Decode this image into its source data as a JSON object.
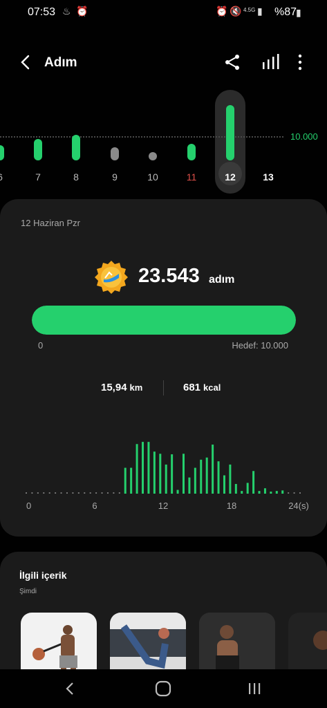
{
  "status": {
    "time": "07:53",
    "battery": "%87",
    "network": "4.5G"
  },
  "header": {
    "title": "Adım"
  },
  "week": {
    "goal_label": "10.000",
    "days": [
      {
        "label": "6",
        "steps_ratio": 0.65,
        "color": "green"
      },
      {
        "label": "7",
        "steps_ratio": 0.9,
        "color": "green"
      },
      {
        "label": "8",
        "steps_ratio": 1.1,
        "color": "green"
      },
      {
        "label": "9",
        "steps_ratio": 0.55,
        "color": "gray"
      },
      {
        "label": "10",
        "steps_ratio": 0.0,
        "color": "gray"
      },
      {
        "label": "11",
        "steps_ratio": 0.7,
        "color": "green"
      },
      {
        "label": "12",
        "steps_ratio": 2.35,
        "color": "green"
      },
      {
        "label": "13",
        "steps_ratio": 0,
        "color": "none"
      }
    ],
    "selected": "12"
  },
  "card": {
    "date": "12 Haziran Pzr",
    "steps": "23.543",
    "steps_unit": "adım",
    "progress_fraction": 1.0,
    "progress_min": "0",
    "goal_text": "Hedef: 10.000",
    "distance_value": "15,94",
    "distance_unit": "km",
    "calorie_value": "681",
    "calorie_unit": "kcal"
  },
  "chart_data": {
    "type": "bar",
    "x_ticks": [
      "0",
      "6",
      "12",
      "18",
      "24(s)"
    ],
    "xlim": [
      0,
      24
    ],
    "half_hour_values": [
      0,
      0,
      0,
      0,
      0,
      0,
      0,
      0,
      0,
      0,
      0,
      0,
      0,
      0,
      0,
      0,
      0,
      0.48,
      0.48,
      0.92,
      0.96,
      0.96,
      0.78,
      0.74,
      0.54,
      0.73,
      0.07,
      0.74,
      0.3,
      0.48,
      0.63,
      0.67,
      0.91,
      0.6,
      0.34,
      0.54,
      0.18,
      0.05,
      0.2,
      0.42,
      0.05,
      0.1,
      0.02,
      0.05,
      0.06,
      0,
      0,
      0
    ],
    "color": "#25d06d"
  },
  "related": {
    "title": "İlgili içerik",
    "subtitle": "Şimdi"
  },
  "colors": {
    "accent": "#25d06d",
    "card_bg": "#1b1b1b",
    "page_bg": "#010101"
  }
}
